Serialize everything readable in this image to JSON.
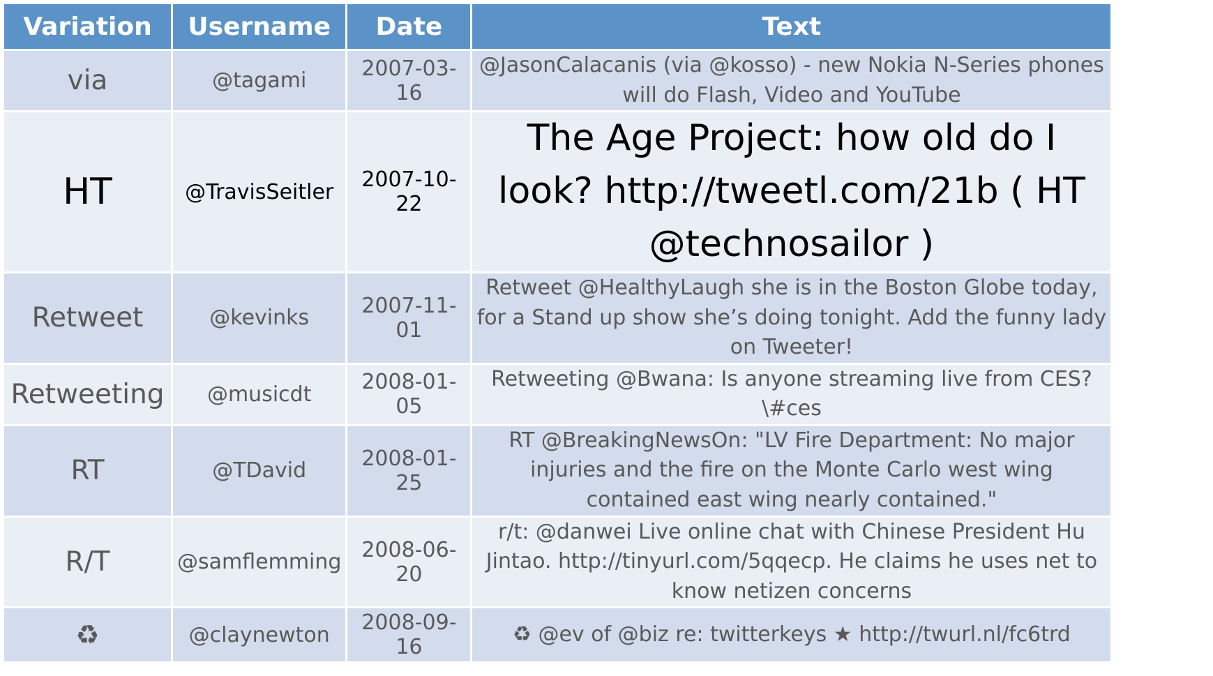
{
  "table": {
    "headers": {
      "variation": "Variation",
      "username": "Username",
      "date": "Date",
      "text": "Text"
    },
    "rows": [
      {
        "variation": "via",
        "username": "@tagami",
        "date": "2007-03-16",
        "text": "@JasonCalacanis (via @kosso) - new Nokia N-Series phones will do Flash, Video and YouTube"
      },
      {
        "variation": "HT",
        "username": "@TravisSeitler",
        "date": "2007-10-22",
        "text": "The Age Project: how old do I look? http://tweetl.com/21b ( HT @technosailor )"
      },
      {
        "variation": "Retweet",
        "username": "@kevinks",
        "date": "2007-11-01",
        "text": "Retweet @HealthyLaugh she is in the Boston Globe today, for a Stand up show she’s doing tonight. Add the funny lady on Tweeter!"
      },
      {
        "variation": "Retweeting",
        "username": "@musicdt",
        "date": "2008-01-05",
        "text": "Retweeting @Bwana: Is anyone streaming live from CES? \\#ces"
      },
      {
        "variation": "RT",
        "username": "@TDavid",
        "date": "2008-01-25",
        "text": "RT @BreakingNewsOn: \"LV Fire Department: No major injuries and the fire on the Monte Carlo west wing contained east wing nearly contained.\""
      },
      {
        "variation": "R/T",
        "username": "@samflemming",
        "date": "2008-06-20",
        "text": "r/t: @danwei Live online chat with Chinese President Hu Jintao. http://tinyurl.com/5qqecp. He claims he uses net to know netizen concerns"
      },
      {
        "variation": "recycle-icon",
        "username": "@claynewton",
        "date": "2008-09-16",
        "text_parts": {
          "icon": "recycle-icon",
          "body": "@ev of @biz re: twitterkeys",
          "star_icon": "star-icon",
          "link": "http://twurl.nl/fc6trd"
        }
      }
    ]
  },
  "colors": {
    "header_bg": "#5b93c9",
    "row_dark": "#d3dcec",
    "row_light": "#eaeef5",
    "text_gray": "#595959",
    "highlight_text": "#000000"
  }
}
